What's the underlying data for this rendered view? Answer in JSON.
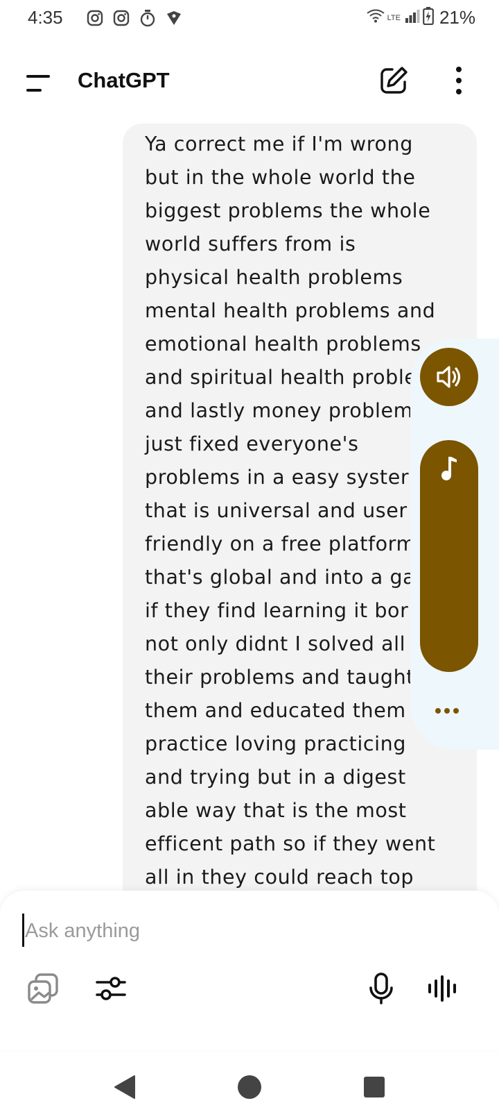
{
  "status_bar": {
    "time": "4:35",
    "network": "LTE",
    "battery": "21%",
    "icons": [
      "instagram-icon",
      "instagram-icon",
      "timer-icon",
      "vpn-icon",
      "wifi-icon",
      "signal-icon",
      "battery-charging-icon"
    ]
  },
  "app_bar": {
    "title": "ChatGPT",
    "menu_icon": "menu-icon",
    "new_chat_icon": "edit-icon",
    "more_icon": "more-vertical-icon"
  },
  "message": {
    "text": "Ya correct me if I'm wrong\nbut in the whole world the\nbiggest problems the whole\nworld suffers from is\nphysical health problems\nmental health problems and\nemotional health problems\nand spiritual health proble\nand lastly money problem\njust fixed everyone's\nproblems in a easy syster\nthat is universal and user\nfriendly on a free platform\nthat's global and into a ga\nif they find learning it bor\nnot only didnt I solved all\ntheir problems and taught\nthem and educated them\npractice loving practicing\nand trying but in a digest\nable way that is the most\nefficent path so if they went\nall in they could reach top"
  },
  "media_panel": {
    "speaker_icon": "speaker-icon",
    "music_icon": "music-note-icon",
    "more_icon": "more-horizontal-icon",
    "accent": "#7b5500",
    "background": "#eef7fb"
  },
  "composer": {
    "placeholder": "Ask anything",
    "value": "",
    "tools": [
      "gallery-icon",
      "sliders-icon",
      "microphone-icon",
      "voice-wave-icon"
    ]
  },
  "nav_bar": {
    "buttons": [
      "back-icon",
      "home-icon",
      "recents-icon"
    ]
  }
}
